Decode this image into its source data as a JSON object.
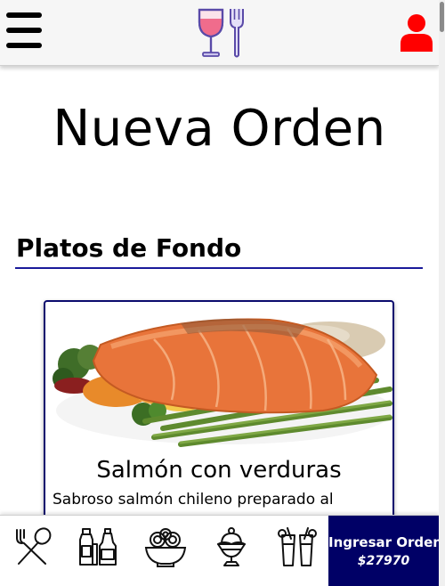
{
  "header": {
    "menu_icon": "hamburger-menu-icon",
    "logo_icon": "wine-glass-fork-logo",
    "user_icon": "user-icon",
    "colors": {
      "background": "#f6f6f6",
      "user": "#ff0000",
      "logo_wine": "#f06c8c",
      "logo_outline": "#5a4aa8"
    }
  },
  "main": {
    "title": "Nueva Orden",
    "section_title": "Platos de Fondo",
    "section_rule_color": "#1a1a9a"
  },
  "card": {
    "image_alt": "salmon-dish-image",
    "title": "Salmón con verduras",
    "description": "Sabroso salmón chileno preparado al",
    "border_color": "#0b0b6e"
  },
  "bottom_nav": {
    "categories": [
      {
        "icon": "utensils-spoon-fork-icon"
      },
      {
        "icon": "condiment-bottles-icon"
      },
      {
        "icon": "pasta-bowl-icon"
      },
      {
        "icon": "ice-cream-sundae-icon"
      },
      {
        "icon": "drinks-glasses-icon"
      }
    ],
    "order_button": {
      "label": "Ingresar Orden",
      "price": "$27970",
      "background": "#000066"
    }
  }
}
